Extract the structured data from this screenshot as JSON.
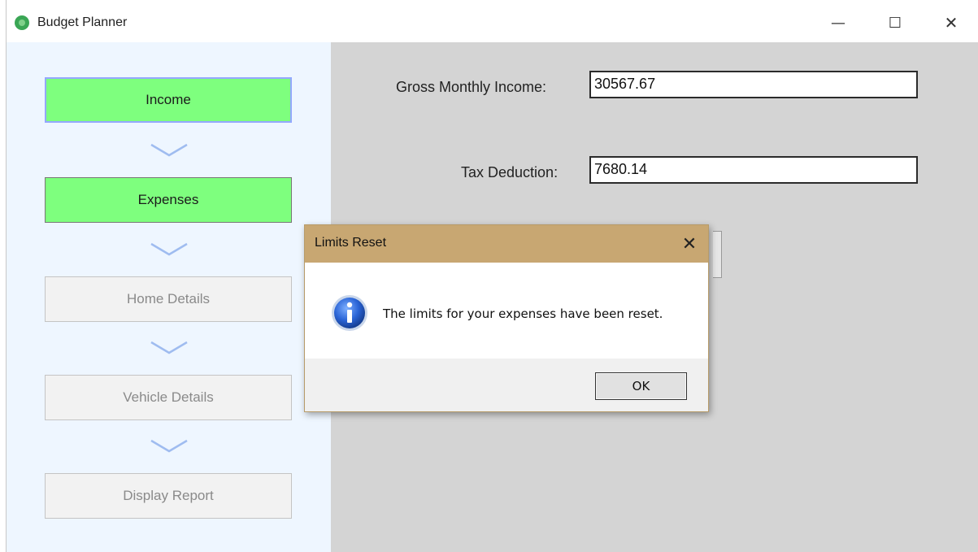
{
  "window": {
    "title": "Budget Planner",
    "minimize_glyph": "—",
    "maximize_glyph": "☐",
    "close_glyph": "✕"
  },
  "sidebar": {
    "steps": [
      {
        "label": "Income",
        "state": "active"
      },
      {
        "label": "Expenses",
        "state": "active"
      },
      {
        "label": "Home Details",
        "state": "disabled"
      },
      {
        "label": "Vehicle Details",
        "state": "disabled"
      },
      {
        "label": "Display Report",
        "state": "disabled"
      }
    ]
  },
  "form": {
    "gross_income_label": "Gross Monthly Income:",
    "gross_income_value": "30567.67",
    "tax_label": "Tax Deduction:",
    "tax_value": "7680.14"
  },
  "dialog": {
    "title": "Limits Reset",
    "close_glyph": "✕",
    "message": "The limits for your expenses have been reset.",
    "ok_label": "OK",
    "icon": "info-icon"
  },
  "colors": {
    "active_step": "#7eff7e",
    "dialog_titlebar": "#c8a772",
    "sidebar_bg": "#eef6ff",
    "content_bg": "#d4d4d4"
  }
}
